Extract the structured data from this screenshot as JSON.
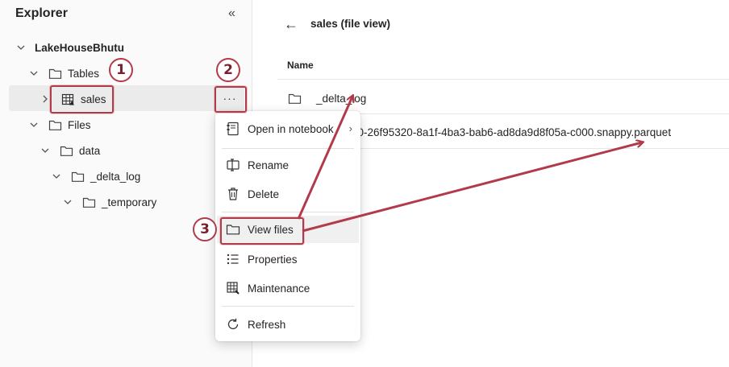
{
  "explorer": {
    "title": "Explorer",
    "collapse_glyph": "«",
    "tree": {
      "root": "LakeHouseBhutu",
      "tables": "Tables",
      "sales": "sales",
      "files": "Files",
      "data": "data",
      "delta_log": "_delta_log",
      "temporary": "_temporary"
    },
    "more_label": "···"
  },
  "file_view": {
    "back_glyph": "←",
    "title": "sales (file view)",
    "column_name": "Name",
    "rows": [
      "_delta_log",
      "part-00000-26f95320-8a1f-4ba3-bab6-ad8da9d8f05a-c000.snappy.parquet"
    ],
    "row2_visible": "00-26f95320-8a1f-4ba3-bab6-ad8da9d8f05a-c000.snappy.parquet"
  },
  "context_menu": {
    "open_in_notebook": "Open in notebook",
    "rename": "Rename",
    "delete": "Delete",
    "view_files": "View files",
    "properties": "Properties",
    "maintenance": "Maintenance",
    "refresh": "Refresh",
    "submenu_glyph": "›"
  },
  "annotations": {
    "badge1": "1",
    "badge2": "2",
    "badge3": "3",
    "color": "#b23a4a"
  },
  "icons": [
    "chevron-down-icon",
    "chevron-right-icon",
    "folder-icon",
    "table-icon",
    "notebook-icon",
    "rename-icon",
    "delete-icon",
    "properties-icon",
    "maintenance-icon",
    "refresh-icon",
    "back-arrow-icon",
    "collapse-icon"
  ]
}
